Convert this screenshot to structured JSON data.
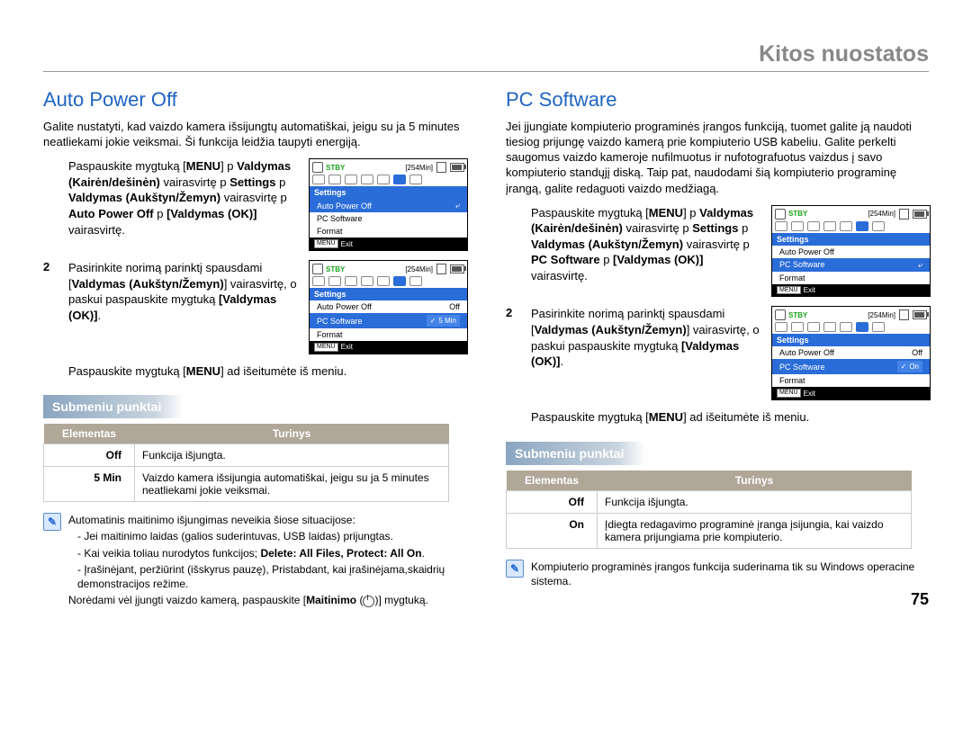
{
  "page": {
    "categoryTitle": "Kitos nuostatos",
    "number": "75"
  },
  "left": {
    "heading": "Auto Power Off",
    "intro": "Galite nustatyti, kad vaizdo kamera išsijungtų automatiškai, jeigu su ja 5 minutes neatliekami jokie veiksmai. Ši funkcija leidžia taupyti energiją.",
    "step1_num": "",
    "step1_a": "Paspauskite mygtuką [",
    "step1_menu": "MENU",
    "step1_b": "] p ",
    "step1_b2": "Valdymas (Kairėn/dešinėn)",
    "step1_c": " vairasvirtę p ",
    "step1_settings": "Settings",
    "step1_d": " p ",
    "step1_d2": "Valdymas (Aukštyn/Žemyn)",
    "step1_e": " vairasvirtę p ",
    "step1_item": "Auto Power Off",
    "step1_f": " p ",
    "step1_ok": "[Valdymas (OK)]",
    "step1_g": " vairasvirtę.",
    "step2_num": "2",
    "step2_a": "Pasirinkite norimą parinktį spausdami [",
    "step2_b": "Valdymas (Aukštyn/Žemyn)",
    "step2_c": "] vairasvirtę, o paskui paspauskite mygtuką ",
    "step2_ok": "[Valdymas (OK)]",
    "step2_d": ".",
    "step3_num": "",
    "step3_a": "Paspauskite mygtuką [",
    "step3_menu": "MENU",
    "step3_b": "] ad išeitumėte iš meniu.",
    "submenuHeading": "Submeniu punktai",
    "tbl": {
      "hElem": "Elementas",
      "hTur": "Turinys",
      "rows": [
        {
          "elem": "Off",
          "tur": "Funkcija išjungta."
        },
        {
          "elem": "5 Min",
          "tur": "Vaizdo kamera išsijungia automatiškai, jeigu su ja 5 minutes neatliekami jokie veiksmai."
        }
      ]
    },
    "note_a": "Automatinis maitinimo išjungimas neveikia šiose situacijose:",
    "note_a1": "Jei maitinimo laidas (galios suderintuvas, USB laidas) prijungtas.",
    "note_a2_a": "Kai veikia toliau nurodytos funkcijos; ",
    "note_a2_b": "Delete: All Files, Protect: All On",
    "note_a3": "Įrašinėjant, peržiūrint (išskyrus pauzę), Pristabdant, kai įrašinėjama,skaidrių demonstracijos režime.",
    "note_b_a": "Norėdami vėl įjungti vaizdo kamerą, paspauskite [",
    "note_b_b": "Maitinimo",
    "note_b_c": "] mygtuką.",
    "lcd1": {
      "stby": "STBY",
      "time": "[254Min]",
      "header": "Settings",
      "i1": "Auto Power Off",
      "i2": "PC Software",
      "i3": "Format",
      "exit": "Exit"
    },
    "lcd2": {
      "stby": "STBY",
      "time": "[254Min]",
      "header": "Settings",
      "i1": "Auto Power Off",
      "i1v": "Off",
      "i2": "PC Software",
      "i2v": "5 Min",
      "i3": "Format",
      "exit": "Exit"
    }
  },
  "right": {
    "heading": "PC Software",
    "intro": "Jei įjungiate kompiuterio programinės įrangos funkciją, tuomet galite ją naudoti tiesiog prijungę vaizdo kamerą prie kompiuterio USB kabeliu. Galite perkelti saugomus vaizdo kameroje nufilmuotus ir nufotografuotus vaizdus į savo kompiuterio standųjį diską. Taip pat, naudodami šią kompiuterio programinę įrangą, galite redaguoti vaizdo medžiagą.",
    "step1_num": "",
    "step1_a": "Paspauskite mygtuką [",
    "step1_menu": "MENU",
    "step1_b": "] p ",
    "step1_b2": "Valdymas (Kairėn/dešinėn)",
    "step1_c": " vairasvirtę p ",
    "step1_settings": "Settings",
    "step1_d": " p ",
    "step1_d2": "Valdymas (Aukštyn/Žemyn)",
    "step1_e": " vairasvirtę p ",
    "step1_item": "PC Software",
    "step1_f": " p ",
    "step1_ok": "[Valdymas (OK)]",
    "step1_g": " vairasvirtę.",
    "step2_num": "2",
    "step2_a": "Pasirinkite norimą parinktį spausdami [",
    "step2_b": "Valdymas (Aukštyn/Žemyn)",
    "step2_c": "] vairasvirtę, o paskui paspauskite mygtuką ",
    "step2_ok": "[Valdymas (OK)]",
    "step2_d": ".",
    "step3_num": "",
    "step3_a": "Paspauskite mygtuką [",
    "step3_menu": "MENU",
    "step3_b": "] ad išeitumėte iš meniu.",
    "submenuHeading": "Submeniu punktai",
    "tbl": {
      "hElem": "Elementas",
      "hTur": "Turinys",
      "rows": [
        {
          "elem": "Off",
          "tur": "Funkcija išjungta."
        },
        {
          "elem": "On",
          "tur": "Įdiegta redagavimo programinė įranga įsijungia, kai vaizdo kamera prijungiama prie kompiuterio."
        }
      ]
    },
    "note": "Kompiuterio programinės įrangos funkcija suderinama tik su Windows operacine sistema.",
    "lcd1": {
      "stby": "STBY",
      "time": "[254Min]",
      "header": "Settings",
      "i1": "Auto Power Off",
      "i2": "PC Software",
      "i3": "Format",
      "exit": "Exit"
    },
    "lcd2": {
      "stby": "STBY",
      "time": "[254Min]",
      "header": "Settings",
      "i1": "Auto Power Off",
      "i1v": "Off",
      "i2": "PC Software",
      "i2v": "On",
      "i3": "Format",
      "exit": "Exit"
    }
  }
}
